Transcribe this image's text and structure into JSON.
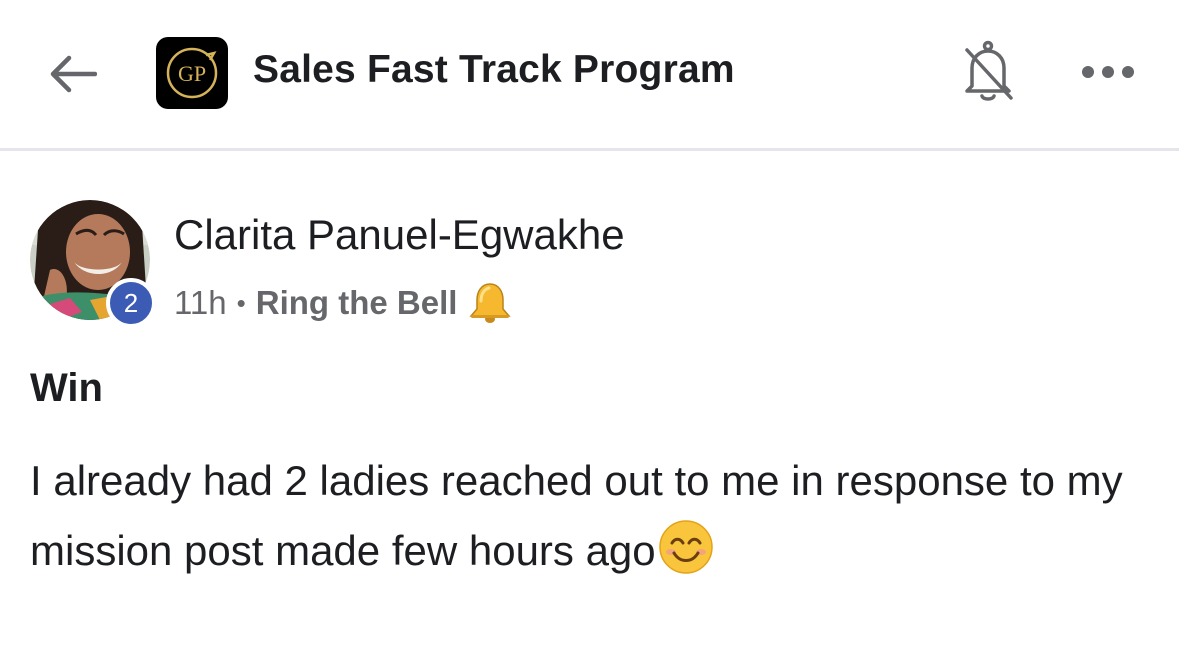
{
  "header": {
    "group_title": "Sales Fast Track Program",
    "logo_text": "GP",
    "back_icon": "arrow-left-icon",
    "notification_icon": "bell-off-icon",
    "more_icon": "more-horizontal-icon"
  },
  "post": {
    "author": "Clarita Panuel-Egwakhe",
    "badge_count": "2",
    "time": "11h",
    "separator": "•",
    "topic": "Ring the Bell",
    "topic_emoji": "bell-emoji",
    "heading": "Win",
    "body": "I already had 2 ladies reached out to me in response to my mission post made few hours ago",
    "body_emoji": "smiling-face-emoji"
  },
  "colors": {
    "badge": "#3b5bb5",
    "meta_text": "#65676b",
    "primary_text": "#1c1e21",
    "divider": "#e4e6eb"
  }
}
